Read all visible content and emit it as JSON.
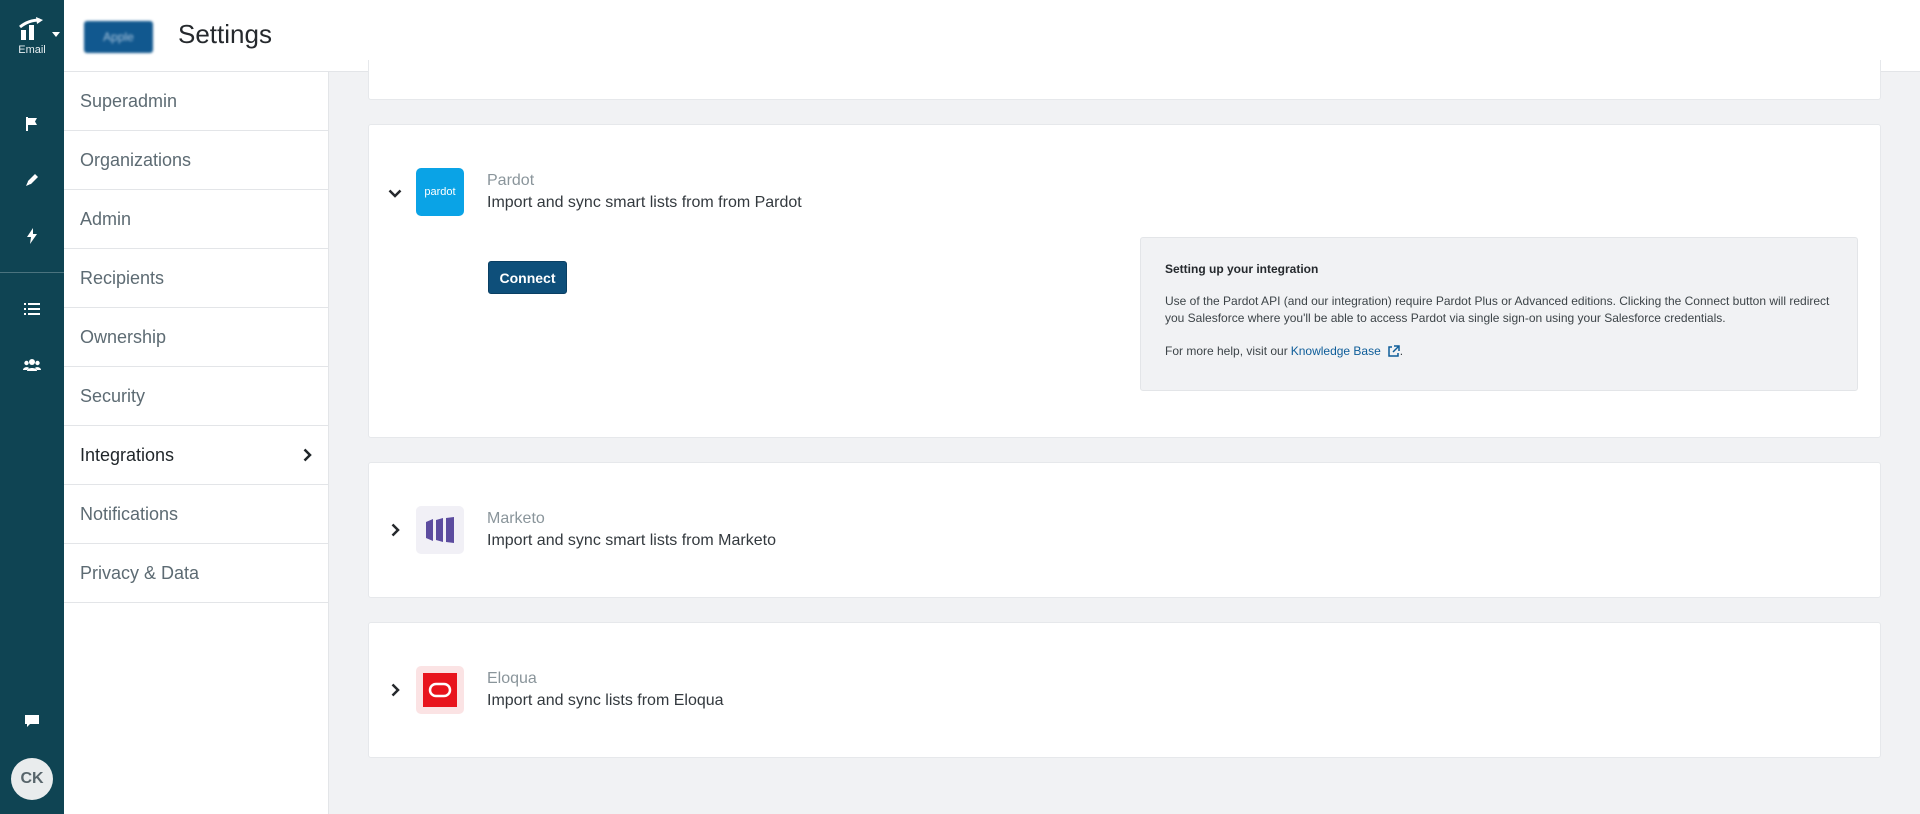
{
  "app": {
    "product_label": "Email",
    "org_badge": "Apple",
    "avatar_initials": "CK"
  },
  "header": {
    "title": "Settings"
  },
  "rail": {
    "icons": [
      "flag-icon",
      "pencil-icon",
      "bolt-icon",
      "list-icon",
      "users-icon",
      "chat-icon"
    ]
  },
  "sidebar": {
    "items": [
      {
        "label": "Superadmin"
      },
      {
        "label": "Organizations"
      },
      {
        "label": "Admin"
      },
      {
        "label": "Recipients"
      },
      {
        "label": "Ownership"
      },
      {
        "label": "Security"
      },
      {
        "label": "Integrations",
        "active": true
      },
      {
        "label": "Notifications"
      },
      {
        "label": "Privacy & Data"
      }
    ]
  },
  "integrations": {
    "pardot": {
      "name": "Pardot",
      "logo_text": "pardot",
      "description": "Import and sync smart lists from from Pardot",
      "expanded": true,
      "connect_label": "Connect",
      "help_title": "Setting up your integration",
      "help_body": "Use of the Pardot API (and our integration) require Pardot Plus or Advanced editions. Clicking the Connect button will redirect you Salesforce where you'll be able to access Pardot via single sign-on using your Salesforce credentials.",
      "help_more_prefix": "For more help, visit our",
      "help_link": "Knowledge Base",
      "help_more_suffix": "."
    },
    "marketo": {
      "name": "Marketo",
      "description": "Import and sync smart lists from Marketo",
      "expanded": false
    },
    "eloqua": {
      "name": "Eloqua",
      "description": "Import and sync lists from Eloqua",
      "expanded": false
    }
  },
  "colors": {
    "rail": "#0f4453",
    "primary_button": "#0e4f7a",
    "pardot_brand": "#0aa3e6",
    "marketo_brand": "#5c4c9f",
    "eloqua_brand": "#e8141d"
  }
}
